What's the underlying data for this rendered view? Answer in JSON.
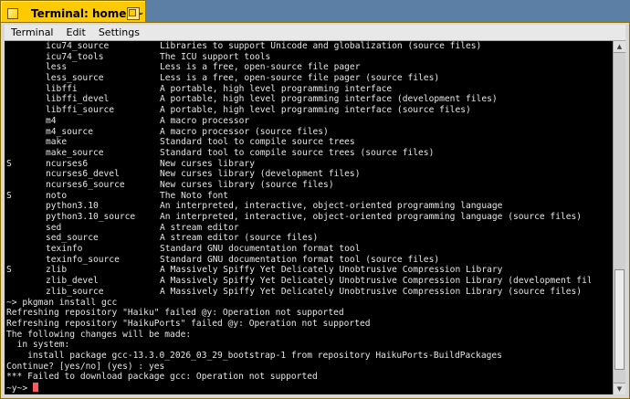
{
  "window": {
    "title": "Terminal: home: ~"
  },
  "menubar": {
    "items": [
      "Terminal",
      "Edit",
      "Settings"
    ]
  },
  "package_list": [
    {
      "flag": "",
      "name": "icu74_source",
      "desc": "Libraries to support Unicode and globalization (source files)"
    },
    {
      "flag": "",
      "name": "icu74_tools",
      "desc": "The ICU support tools"
    },
    {
      "flag": "",
      "name": "less",
      "desc": "Less is a free, open-source file pager"
    },
    {
      "flag": "",
      "name": "less_source",
      "desc": "Less is a free, open-source file pager (source files)"
    },
    {
      "flag": "",
      "name": "libffi",
      "desc": "A portable, high level programming interface"
    },
    {
      "flag": "",
      "name": "libffi_devel",
      "desc": "A portable, high level programming interface (development files)"
    },
    {
      "flag": "",
      "name": "libffi_source",
      "desc": "A portable, high level programming interface (source files)"
    },
    {
      "flag": "",
      "name": "m4",
      "desc": "A macro processor"
    },
    {
      "flag": "",
      "name": "m4_source",
      "desc": "A macro processor (source files)"
    },
    {
      "flag": "",
      "name": "make",
      "desc": "Standard tool to compile source trees"
    },
    {
      "flag": "",
      "name": "make_source",
      "desc": "Standard tool to compile source trees (source files)"
    },
    {
      "flag": "S",
      "name": "ncurses6",
      "desc": "New curses library"
    },
    {
      "flag": "",
      "name": "ncurses6_devel",
      "desc": "New curses library (development files)"
    },
    {
      "flag": "",
      "name": "ncurses6_source",
      "desc": "New curses library (source files)"
    },
    {
      "flag": "S",
      "name": "noto",
      "desc": "The Noto font"
    },
    {
      "flag": "",
      "name": "python3.10",
      "desc": "An interpreted, interactive, object-oriented programming language"
    },
    {
      "flag": "",
      "name": "python3.10_source",
      "desc": "An interpreted, interactive, object-oriented programming language (source files)"
    },
    {
      "flag": "",
      "name": "sed",
      "desc": "A stream editor"
    },
    {
      "flag": "",
      "name": "sed_source",
      "desc": "A stream editor (source files)"
    },
    {
      "flag": "",
      "name": "texinfo",
      "desc": "Standard GNU documentation format tool"
    },
    {
      "flag": "",
      "name": "texinfo_source",
      "desc": "Standard GNU documentation format tool (source files)"
    },
    {
      "flag": "S",
      "name": "zlib",
      "desc": "A Massively Spiffy Yet Delicately Unobtrusive Compression Library"
    },
    {
      "flag": "",
      "name": "zlib_devel",
      "desc": "A Massively Spiffy Yet Delicately Unobtrusive Compression Library (development files)"
    },
    {
      "flag": "",
      "name": "zlib_source",
      "desc": "A Massively Spiffy Yet Delicately Unobtrusive Compression Library (source files)"
    }
  ],
  "output_lines": [
    "~> pkgman install gcc",
    "Refreshing repository \"Haiku\" failed @y: Operation not supported",
    "Refreshing repository \"HaikuPorts\" failed @y: Operation not supported",
    "The following changes will be made:",
    "  in system:",
    "    install package gcc-13.3.0_2026_03_29_bootstrap-1 from repository HaikuPorts-BuildPackages",
    "Continue? [yes/no] (yes) : yes",
    "*** Failed to download package gcc: Operation not supported"
  ],
  "prompt": {
    "text": "~y~> "
  },
  "colors": {
    "tab_yellow": "#ffcb00",
    "terminal_bg": "#000000",
    "terminal_fg": "#e6e6e6",
    "cursor": "#ff5a5a",
    "desktop": "#5c7fa6"
  }
}
